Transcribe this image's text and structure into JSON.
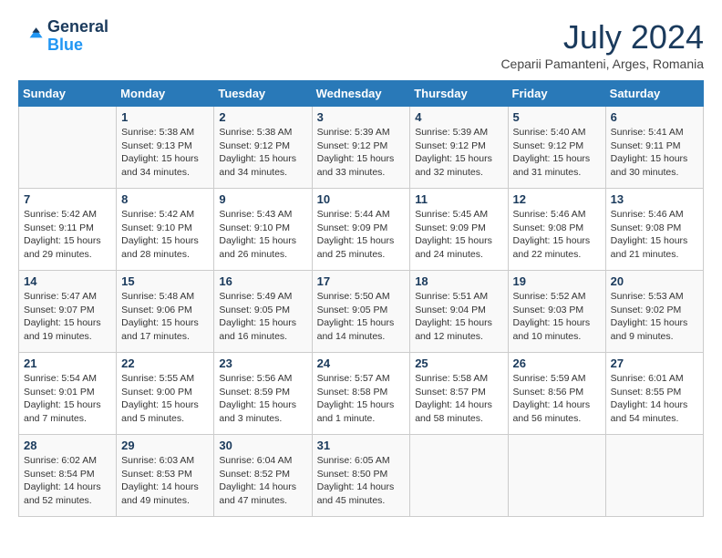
{
  "header": {
    "logo_line1": "General",
    "logo_line2": "Blue",
    "month": "July 2024",
    "location": "Ceparii Pamanteni, Arges, Romania"
  },
  "days_of_week": [
    "Sunday",
    "Monday",
    "Tuesday",
    "Wednesday",
    "Thursday",
    "Friday",
    "Saturday"
  ],
  "weeks": [
    [
      {
        "day": "",
        "sunrise": "",
        "sunset": "",
        "daylight": ""
      },
      {
        "day": "1",
        "sunrise": "Sunrise: 5:38 AM",
        "sunset": "Sunset: 9:13 PM",
        "daylight": "Daylight: 15 hours and 34 minutes."
      },
      {
        "day": "2",
        "sunrise": "Sunrise: 5:38 AM",
        "sunset": "Sunset: 9:12 PM",
        "daylight": "Daylight: 15 hours and 34 minutes."
      },
      {
        "day": "3",
        "sunrise": "Sunrise: 5:39 AM",
        "sunset": "Sunset: 9:12 PM",
        "daylight": "Daylight: 15 hours and 33 minutes."
      },
      {
        "day": "4",
        "sunrise": "Sunrise: 5:39 AM",
        "sunset": "Sunset: 9:12 PM",
        "daylight": "Daylight: 15 hours and 32 minutes."
      },
      {
        "day": "5",
        "sunrise": "Sunrise: 5:40 AM",
        "sunset": "Sunset: 9:12 PM",
        "daylight": "Daylight: 15 hours and 31 minutes."
      },
      {
        "day": "6",
        "sunrise": "Sunrise: 5:41 AM",
        "sunset": "Sunset: 9:11 PM",
        "daylight": "Daylight: 15 hours and 30 minutes."
      }
    ],
    [
      {
        "day": "7",
        "sunrise": "Sunrise: 5:42 AM",
        "sunset": "Sunset: 9:11 PM",
        "daylight": "Daylight: 15 hours and 29 minutes."
      },
      {
        "day": "8",
        "sunrise": "Sunrise: 5:42 AM",
        "sunset": "Sunset: 9:10 PM",
        "daylight": "Daylight: 15 hours and 28 minutes."
      },
      {
        "day": "9",
        "sunrise": "Sunrise: 5:43 AM",
        "sunset": "Sunset: 9:10 PM",
        "daylight": "Daylight: 15 hours and 26 minutes."
      },
      {
        "day": "10",
        "sunrise": "Sunrise: 5:44 AM",
        "sunset": "Sunset: 9:09 PM",
        "daylight": "Daylight: 15 hours and 25 minutes."
      },
      {
        "day": "11",
        "sunrise": "Sunrise: 5:45 AM",
        "sunset": "Sunset: 9:09 PM",
        "daylight": "Daylight: 15 hours and 24 minutes."
      },
      {
        "day": "12",
        "sunrise": "Sunrise: 5:46 AM",
        "sunset": "Sunset: 9:08 PM",
        "daylight": "Daylight: 15 hours and 22 minutes."
      },
      {
        "day": "13",
        "sunrise": "Sunrise: 5:46 AM",
        "sunset": "Sunset: 9:08 PM",
        "daylight": "Daylight: 15 hours and 21 minutes."
      }
    ],
    [
      {
        "day": "14",
        "sunrise": "Sunrise: 5:47 AM",
        "sunset": "Sunset: 9:07 PM",
        "daylight": "Daylight: 15 hours and 19 minutes."
      },
      {
        "day": "15",
        "sunrise": "Sunrise: 5:48 AM",
        "sunset": "Sunset: 9:06 PM",
        "daylight": "Daylight: 15 hours and 17 minutes."
      },
      {
        "day": "16",
        "sunrise": "Sunrise: 5:49 AM",
        "sunset": "Sunset: 9:05 PM",
        "daylight": "Daylight: 15 hours and 16 minutes."
      },
      {
        "day": "17",
        "sunrise": "Sunrise: 5:50 AM",
        "sunset": "Sunset: 9:05 PM",
        "daylight": "Daylight: 15 hours and 14 minutes."
      },
      {
        "day": "18",
        "sunrise": "Sunrise: 5:51 AM",
        "sunset": "Sunset: 9:04 PM",
        "daylight": "Daylight: 15 hours and 12 minutes."
      },
      {
        "day": "19",
        "sunrise": "Sunrise: 5:52 AM",
        "sunset": "Sunset: 9:03 PM",
        "daylight": "Daylight: 15 hours and 10 minutes."
      },
      {
        "day": "20",
        "sunrise": "Sunrise: 5:53 AM",
        "sunset": "Sunset: 9:02 PM",
        "daylight": "Daylight: 15 hours and 9 minutes."
      }
    ],
    [
      {
        "day": "21",
        "sunrise": "Sunrise: 5:54 AM",
        "sunset": "Sunset: 9:01 PM",
        "daylight": "Daylight: 15 hours and 7 minutes."
      },
      {
        "day": "22",
        "sunrise": "Sunrise: 5:55 AM",
        "sunset": "Sunset: 9:00 PM",
        "daylight": "Daylight: 15 hours and 5 minutes."
      },
      {
        "day": "23",
        "sunrise": "Sunrise: 5:56 AM",
        "sunset": "Sunset: 8:59 PM",
        "daylight": "Daylight: 15 hours and 3 minutes."
      },
      {
        "day": "24",
        "sunrise": "Sunrise: 5:57 AM",
        "sunset": "Sunset: 8:58 PM",
        "daylight": "Daylight: 15 hours and 1 minute."
      },
      {
        "day": "25",
        "sunrise": "Sunrise: 5:58 AM",
        "sunset": "Sunset: 8:57 PM",
        "daylight": "Daylight: 14 hours and 58 minutes."
      },
      {
        "day": "26",
        "sunrise": "Sunrise: 5:59 AM",
        "sunset": "Sunset: 8:56 PM",
        "daylight": "Daylight: 14 hours and 56 minutes."
      },
      {
        "day": "27",
        "sunrise": "Sunrise: 6:01 AM",
        "sunset": "Sunset: 8:55 PM",
        "daylight": "Daylight: 14 hours and 54 minutes."
      }
    ],
    [
      {
        "day": "28",
        "sunrise": "Sunrise: 6:02 AM",
        "sunset": "Sunset: 8:54 PM",
        "daylight": "Daylight: 14 hours and 52 minutes."
      },
      {
        "day": "29",
        "sunrise": "Sunrise: 6:03 AM",
        "sunset": "Sunset: 8:53 PM",
        "daylight": "Daylight: 14 hours and 49 minutes."
      },
      {
        "day": "30",
        "sunrise": "Sunrise: 6:04 AM",
        "sunset": "Sunset: 8:52 PM",
        "daylight": "Daylight: 14 hours and 47 minutes."
      },
      {
        "day": "31",
        "sunrise": "Sunrise: 6:05 AM",
        "sunset": "Sunset: 8:50 PM",
        "daylight": "Daylight: 14 hours and 45 minutes."
      },
      {
        "day": "",
        "sunrise": "",
        "sunset": "",
        "daylight": ""
      },
      {
        "day": "",
        "sunrise": "",
        "sunset": "",
        "daylight": ""
      },
      {
        "day": "",
        "sunrise": "",
        "sunset": "",
        "daylight": ""
      }
    ]
  ]
}
